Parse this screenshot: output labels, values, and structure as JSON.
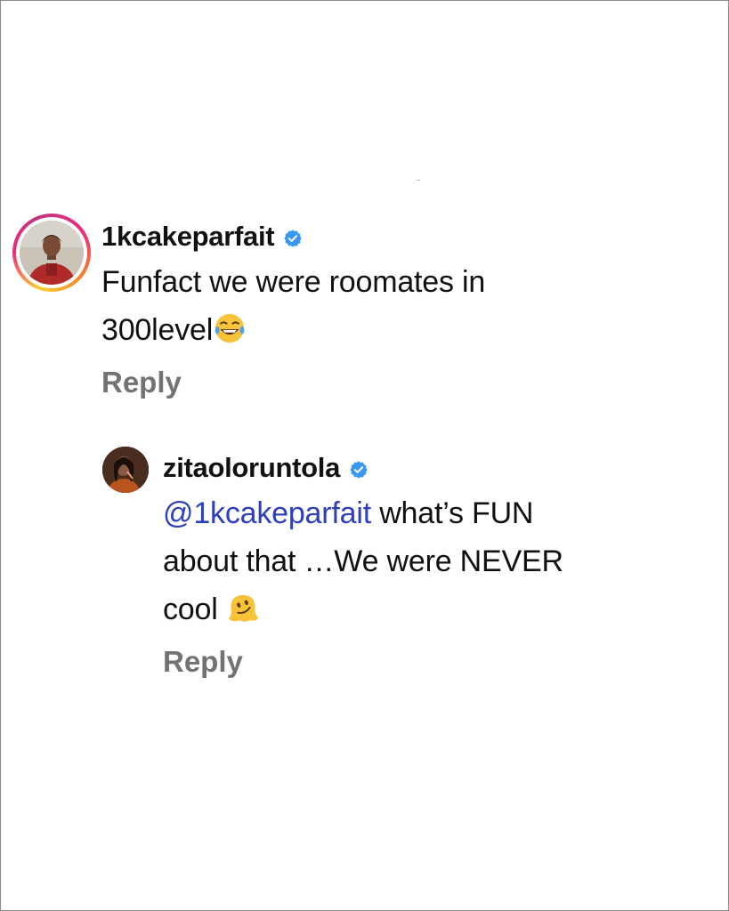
{
  "comments": [
    {
      "username": "1kcakeparfait",
      "text_line1": "Funfact we were roomates in",
      "text_line2": "300level",
      "emoji": "face-with-tears-of-joy",
      "reply_label": "Reply",
      "verified": true
    },
    {
      "username": "zitaoloruntola",
      "mention": "@1kcakeparfait",
      "text_rest_line1": " what’s FUN",
      "text_line2": "about that …We were NEVER",
      "text_line3": "cool ",
      "emoji": "melting-face",
      "reply_label": "Reply",
      "verified": true
    }
  ],
  "colors": {
    "username": "#111111",
    "text": "#111111",
    "mention": "#2d3fbd",
    "reply": "#737373",
    "verified": "#3897f0"
  }
}
